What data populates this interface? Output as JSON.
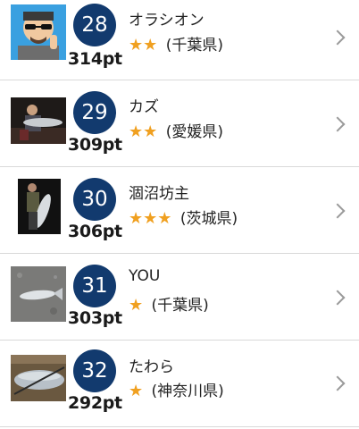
{
  "rankings": [
    {
      "rank": "28",
      "points": "314pt",
      "name": "オラシオン",
      "stars": "★★",
      "prefecture": "(千葉県)",
      "thumb_icon": "avatar-cartoon-man-icon"
    },
    {
      "rank": "29",
      "points": "309pt",
      "name": "カズ",
      "stars": "★★",
      "prefecture": "(愛媛県)",
      "thumb_icon": "fish-catch-photo-icon"
    },
    {
      "rank": "30",
      "points": "306pt",
      "name": "涸沼坊主",
      "stars": "★★★",
      "prefecture": "(茨城県)",
      "thumb_icon": "fish-catch-night-photo-icon"
    },
    {
      "rank": "31",
      "points": "303pt",
      "name": "YOU",
      "stars": "★",
      "prefecture": "(千葉県)",
      "thumb_icon": "fish-on-ground-photo-icon"
    },
    {
      "rank": "32",
      "points": "292pt",
      "name": "たわら",
      "stars": "★",
      "prefecture": "(神奈川県)",
      "thumb_icon": "fish-close-photo-icon"
    }
  ],
  "colors": {
    "rank_circle": "#123a6e",
    "star": "#f0a020",
    "separator": "#d9d9d9"
  }
}
